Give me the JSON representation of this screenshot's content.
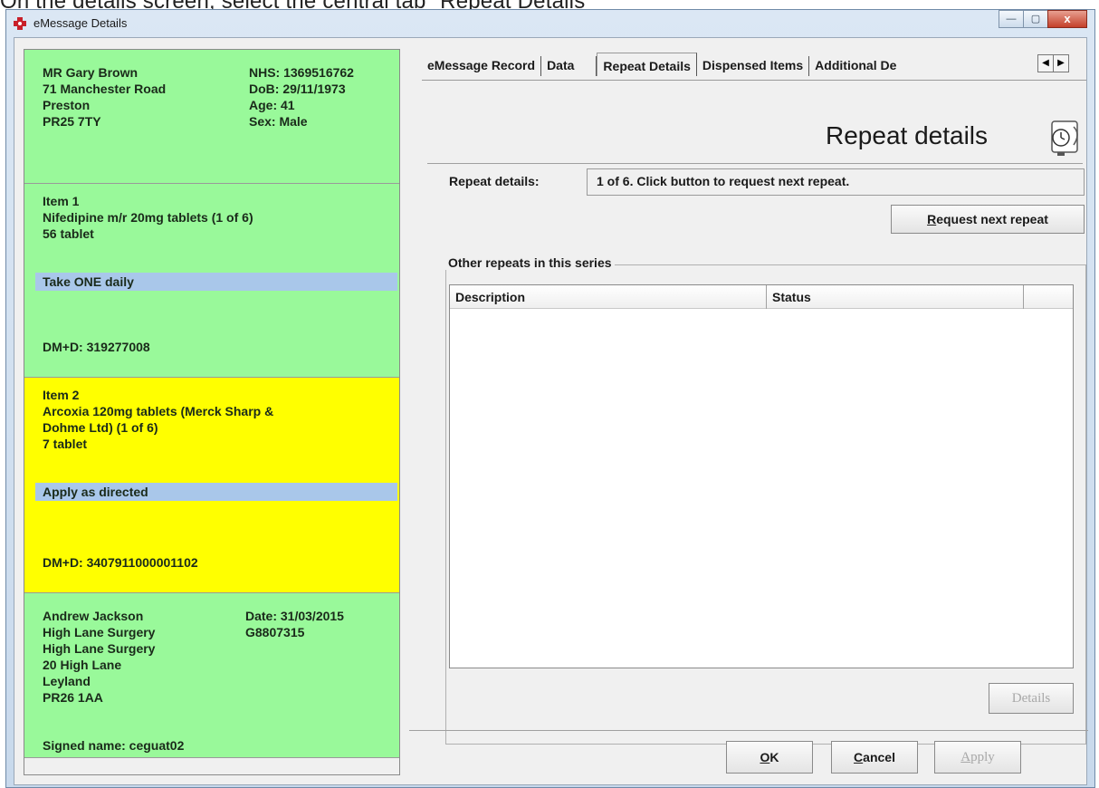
{
  "caption": "On the details screen, select the central tab \"Repeat Details\"",
  "window": {
    "title": "eMessage Details",
    "minimize": "—",
    "maximize": "▢",
    "close": "x"
  },
  "patient": {
    "name": "MR Gary Brown",
    "address1": "71 Manchester Road",
    "town": "Preston",
    "postcode": "PR25 7TY",
    "nhs": "NHS: 1369516762",
    "dob": "DoB: 29/11/1973",
    "age": "Age: 41",
    "sex": "Sex: Male"
  },
  "items": [
    {
      "heading": "Item 1",
      "drug": "Nifedipine m/r 20mg tablets (1 of 6)",
      "quantity": "56 tablet",
      "directions": "Take ONE daily",
      "dmd": "DM+D: 319277008"
    },
    {
      "heading": "Item 2",
      "drug_line1": "Arcoxia 120mg tablets (Merck Sharp &",
      "drug_line2": "Dohme Ltd) (1 of 6)",
      "quantity": "7 tablet",
      "directions": "Apply as directed",
      "dmd": "DM+D: 3407911000001102"
    }
  ],
  "prescriber": {
    "name": "Andrew Jackson",
    "surgery1": "High Lane Surgery",
    "surgery2": "High Lane Surgery",
    "street": "20 High Lane",
    "town": "Leyland",
    "postcode": "PR26 1AA",
    "date": "Date: 31/03/2015",
    "code": "G8807315",
    "signed": "Signed name: ceguat02"
  },
  "tabs": [
    {
      "label": "eMessage Record"
    },
    {
      "label": "Data"
    },
    {
      "label": "Repeat Details"
    },
    {
      "label": "Dispensed Items"
    },
    {
      "label": "Additional De"
    }
  ],
  "tab_arrows": {
    "left": "◀",
    "right": "▶"
  },
  "repeat": {
    "heading": "Repeat details",
    "label": "Repeat details:",
    "value": "1 of 6. Click button to request next repeat.",
    "request_button_u": "R",
    "request_button_rest": "equest next repeat"
  },
  "other_repeats": {
    "group_label": "Other repeats in this series",
    "columns": [
      "Description",
      "Status"
    ],
    "details_button": "Details"
  },
  "footer": {
    "ok_u": "O",
    "ok_rest": "K",
    "cancel_u": "C",
    "cancel_rest": "ancel",
    "apply_u": "A",
    "apply_rest": "pply"
  }
}
